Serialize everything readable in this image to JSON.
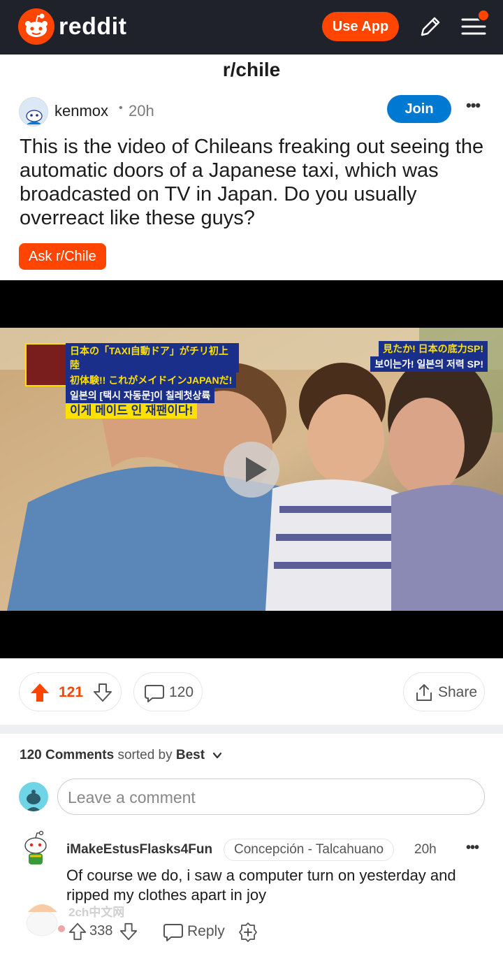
{
  "header": {
    "brand": "reddit",
    "use_app_label": "Use App"
  },
  "subreddit": "r/chile",
  "post": {
    "author": "kenmox",
    "separator": "•",
    "age": "20h",
    "join_label": "Join",
    "more_label": "•••",
    "title": "This is the video of Chileans freaking out seeing the automatic doors of a Japanese taxi, which was broadcasted on TV in Japan. Do you usually overreact like these guys?",
    "flair": "Ask r/Chile",
    "video": {
      "overlay_left": [
        "日本の「TAXI自動ドア」がチリ初上陸",
        "初体験!! これがメイドインJAPANだ!",
        "일본의 [택시 자동문]이 칠레첫상륙",
        "이게 메이드 인 재팬이다!"
      ],
      "overlay_right": [
        "見たか! 日本の底力SP!",
        "보이는가! 일본의 저력 SP!"
      ]
    },
    "vote_count": "121",
    "comment_count": "120",
    "share_label": "Share"
  },
  "comments_section": {
    "count_label": "120 Comments",
    "sorted_by_text": "sorted by",
    "sort_value": "Best",
    "input_placeholder": "Leave a comment"
  },
  "comment": {
    "username": "iMakeEstusFlasks4Fun",
    "flair": "Concepción - Talcahuano",
    "age": "20h",
    "more_label": "•••",
    "body": "Of course we do, i saw a computer turn on yesterday and ripped my clothes apart in joy",
    "score": "338",
    "reply_label": "Reply"
  },
  "watermark": {
    "text": "2ch中文网"
  },
  "colors": {
    "brand_orange": "#ff4500",
    "header_bg": "#20222b",
    "join_blue": "#0079d3"
  }
}
